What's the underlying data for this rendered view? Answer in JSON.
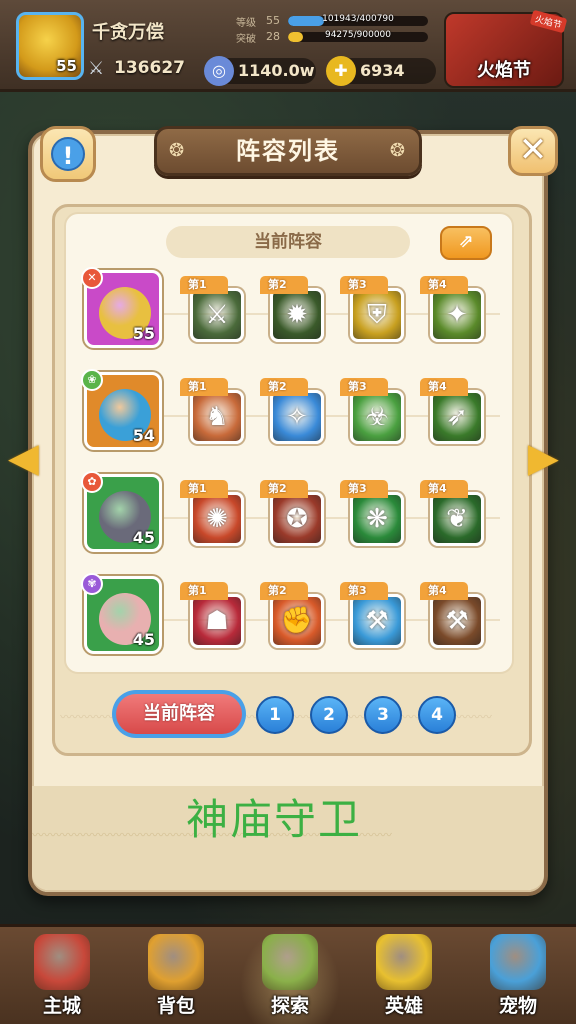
{
  "player": {
    "name": "千贪万偿",
    "level": "55",
    "power": "136627",
    "stats": [
      {
        "label": "等级",
        "num": "55",
        "progress": "101943/400790",
        "fraction": 0.254,
        "color": "#4aa0e8"
      },
      {
        "label": "突破",
        "num": "28",
        "progress": "94275/900000",
        "fraction": 0.105,
        "color": "#f0c030"
      }
    ]
  },
  "currencies": [
    {
      "icon": "swirl-gem-icon",
      "value": "1140.0w",
      "color": "#6a8ad8"
    },
    {
      "icon": "gold-coin-plus-icon",
      "value": "6934",
      "color": "#e8b820"
    }
  ],
  "event": {
    "label": "火焰节",
    "tag": "火焰节"
  },
  "dialog": {
    "title": "阵容列表",
    "current_label": "当前阵容",
    "info_symbol": "!",
    "close_symbol": "✕",
    "share_symbol": "⇗"
  },
  "lineups": [
    {
      "hero_level": "55",
      "hero_color": "#c94ac8",
      "face_color": "#e8c040",
      "element_color": "#e8583a",
      "element_symbol": "✕",
      "skills": [
        {
          "label": "第1",
          "glyph": "⚔",
          "color": "#4a6a3a"
        },
        {
          "label": "第2",
          "glyph": "✹",
          "color": "#3a5a2a"
        },
        {
          "label": "第3",
          "glyph": "⛨",
          "color": "#c8a020"
        },
        {
          "label": "第4",
          "glyph": "✦",
          "color": "#5a8a2a"
        }
      ]
    },
    {
      "hero_level": "54",
      "hero_color": "#e08a2a",
      "face_color": "#3aa0d8",
      "element_color": "#5ab44a",
      "element_symbol": "❀",
      "skills": [
        {
          "label": "第1",
          "glyph": "♞",
          "color": "#c86a3a"
        },
        {
          "label": "第2",
          "glyph": "✧",
          "color": "#3a8ad8"
        },
        {
          "label": "第3",
          "glyph": "☣",
          "color": "#4aa040"
        },
        {
          "label": "第4",
          "glyph": "➶",
          "color": "#3a7a2a"
        }
      ]
    },
    {
      "hero_level": "45",
      "hero_color": "#3aa04a",
      "face_color": "#6a6a7a",
      "element_color": "#e8583a",
      "element_symbol": "✿",
      "skills": [
        {
          "label": "第1",
          "glyph": "✺",
          "color": "#c8482a"
        },
        {
          "label": "第2",
          "glyph": "✪",
          "color": "#9a3a2a"
        },
        {
          "label": "第3",
          "glyph": "❋",
          "color": "#2a8a3a"
        },
        {
          "label": "第4",
          "glyph": "❦",
          "color": "#2a6a2a"
        }
      ]
    },
    {
      "hero_level": "45",
      "hero_color": "#3aa04a",
      "face_color": "#e8b0b0",
      "element_color": "#9a5ad8",
      "element_symbol": "✾",
      "skills": [
        {
          "label": "第1",
          "glyph": "☗",
          "color": "#b82a3a"
        },
        {
          "label": "第2",
          "glyph": "✊",
          "color": "#d85a2a"
        },
        {
          "label": "第3",
          "glyph": "⚒",
          "color": "#3a9ad8"
        },
        {
          "label": "第4",
          "glyph": "⚒",
          "color": "#7a4a2a"
        }
      ]
    }
  ],
  "pager": {
    "current": "当前阵容",
    "pages": [
      "1",
      "2",
      "3",
      "4"
    ]
  },
  "banner_text": "神庙守卫",
  "nav": [
    {
      "label": "主城",
      "color": "#c8483a",
      "active": false
    },
    {
      "label": "背包",
      "color": "#e0a030",
      "active": false
    },
    {
      "label": "探索",
      "color": "#8ab04a",
      "active": true
    },
    {
      "label": "英雄",
      "color": "#e8c030",
      "active": false
    },
    {
      "label": "宠物",
      "color": "#4aa0d8",
      "active": false
    }
  ]
}
